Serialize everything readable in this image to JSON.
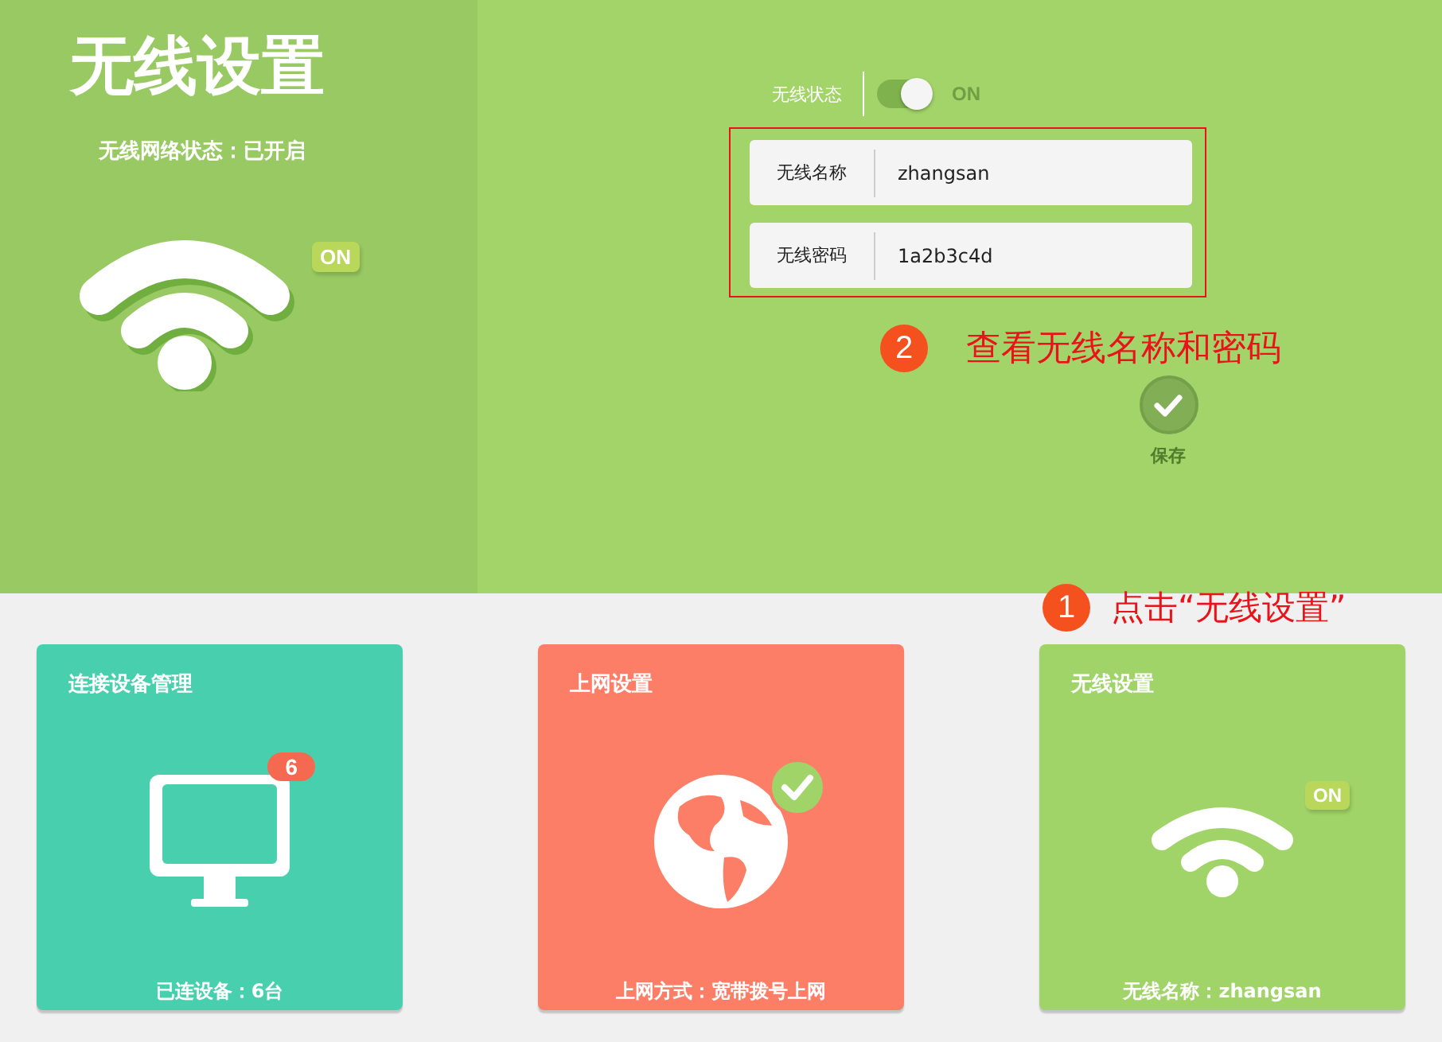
{
  "panel": {
    "title": "无线设置",
    "status_text": "无线网络状态：已开启",
    "badge": "ON"
  },
  "form": {
    "status_label": "无线状态",
    "toggle": {
      "on": true,
      "label": "ON"
    },
    "fields": [
      {
        "label": "无线名称",
        "value": "zhangsan"
      },
      {
        "label": "无线密码",
        "value": "1a2b3c4d"
      }
    ],
    "save_label": "保存"
  },
  "annotations": [
    {
      "number": "2",
      "text": "查看无线名称和密码"
    },
    {
      "number": "1",
      "text": "点击“无线设置”"
    }
  ],
  "cards": [
    {
      "kind": "devices",
      "title": "连接设备管理",
      "badge": "6",
      "caption": "已连设备：6台"
    },
    {
      "kind": "internet",
      "title": "上网设置",
      "caption": "上网方式：宽带拨号上网"
    },
    {
      "kind": "wireless",
      "title": "无线设置",
      "badge": "ON",
      "caption": "无线名称：zhangsan"
    }
  ]
}
